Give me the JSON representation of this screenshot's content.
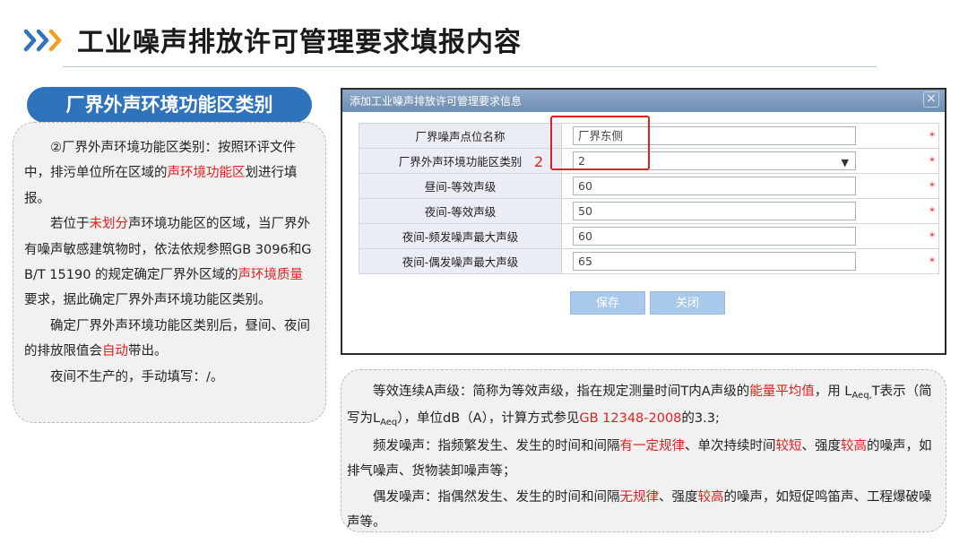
{
  "header": {
    "title": "工业噪声排放许可管理要求填报内容"
  },
  "section": {
    "heading": "厂界外声环境功能区类别"
  },
  "left_panel": {
    "p1": {
      "a": "②厂界外声环境功能区类别：按照环评文件中，排污单位所在区域的",
      "b": "声环境功能区",
      "c": "划进行填报。"
    },
    "p2": {
      "a": "若位于",
      "b": "未划分",
      "c": "声环境功能区的区域，当厂界外有噪声敏感建筑物时，依法依规参照GB 3096和GB/T 15190 的规定确定厂界外区域的",
      "d": "声环境质量",
      "e": "要求，据此确定厂界外声环境功能区类别。"
    },
    "p3": {
      "a": "确定厂界外声环境功能区类别后，昼间、夜间的排放限值会",
      "b": "自动",
      "c": "带出。"
    },
    "p4": "夜间不生产的，手动填写：/。"
  },
  "dialog": {
    "title": "添加工业噪声排放许可管理要求信息",
    "close_icon": "×",
    "required_mark": "*",
    "rows": [
      {
        "label": "厂界噪声点位名称",
        "value": "厂界东侧"
      },
      {
        "label": "厂界外声环境功能区类别",
        "value": "2"
      },
      {
        "label": "昼间-等效声级",
        "value": "60"
      },
      {
        "label": "夜间-等效声级",
        "value": "50"
      },
      {
        "label": "夜间-频发噪声最大声级",
        "value": "60"
      },
      {
        "label": "夜间-偶发噪声最大声级",
        "value": "65"
      }
    ],
    "callout_number": "2",
    "save_label": "保存",
    "close_label": "关闭"
  },
  "right_panel": {
    "p1": {
      "a": "等效连续A声级：简称为等效声级，指在规定测量时间T内A声级的",
      "b": "能量平均值",
      "c": "，用 L",
      "d": "Aeq,",
      "e": "T表示（简写为L",
      "f": "Aeq",
      "g": "），单位dB（A），计算方式参见",
      "h": "GB 12348-2008",
      "i": "的3.3;"
    },
    "p2": {
      "a": "频发噪声：指频繁发生、发生的时间和间隔",
      "b": "有一定规律",
      "c": "、单次持续时间",
      "d": "较短",
      "e": "、强度",
      "f": "较高",
      "g": "的噪声，如排气噪声、货物装卸噪声等；"
    },
    "p3": {
      "a": "偶发噪声：指偶然发生、发生的时间和间隔",
      "b": "无规律",
      "c": "、强度",
      "d": "较高",
      "e": "的噪声，如短促鸣笛声、工程爆破噪声等。"
    }
  },
  "colors": {
    "accent": "#2e73bc",
    "highlight": "#e02020",
    "button": "#a9c9ea"
  }
}
